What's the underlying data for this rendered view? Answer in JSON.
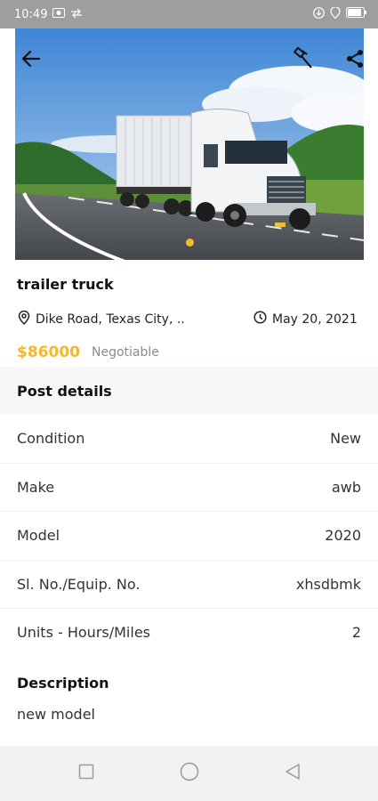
{
  "status_bar": {
    "time": "10:49"
  },
  "listing": {
    "title": "trailer truck",
    "location": "Dike Road, Texas City, ..",
    "date": "May 20, 2021",
    "price": "$86000",
    "price_note": "Negotiable"
  },
  "post_details": {
    "heading": "Post details",
    "rows": [
      {
        "label": "Condition",
        "value": "New"
      },
      {
        "label": "Make",
        "value": "awb"
      },
      {
        "label": "Model",
        "value": "2020"
      },
      {
        "label": "Sl. No./Equip. No.",
        "value": "xhsdbmk"
      },
      {
        "label": "Units - Hours/Miles",
        "value": "2"
      }
    ]
  },
  "description": {
    "heading": "Description",
    "text": "new model"
  },
  "carousel": {
    "current_index": 1,
    "total": 1
  },
  "colors": {
    "accent": "#f5b82e",
    "status_bar": "#9e9e9e",
    "section_bg": "#f6f7f9"
  },
  "icons": {
    "back": "arrow-left-icon",
    "hammer": "hammer-icon",
    "share": "share-icon",
    "location": "location-pin-icon",
    "clock": "clock-icon"
  }
}
